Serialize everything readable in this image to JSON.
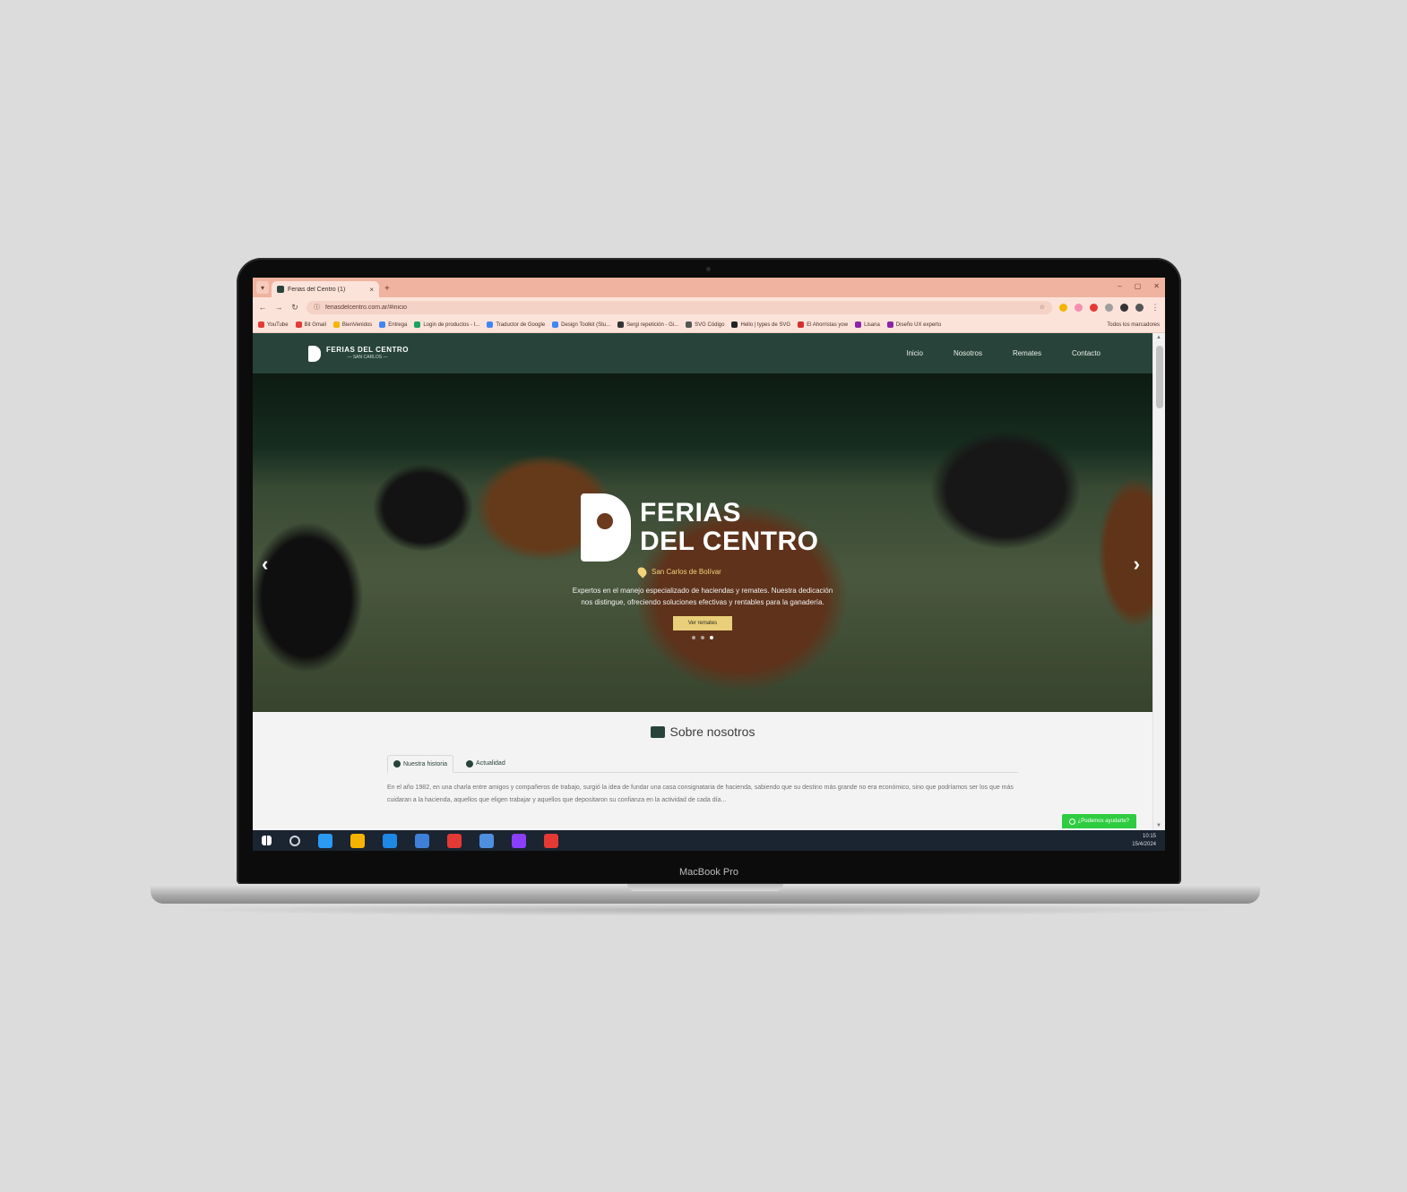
{
  "device": {
    "label": "MacBook Pro"
  },
  "browser": {
    "tab_title": "Ferias del Centro (1)",
    "url": "feriasdelcentro.com.ar/#inicio",
    "bookmarks": [
      {
        "label": "YouTube",
        "color": "#e53935"
      },
      {
        "label": "Bit Gmail",
        "color": "#e53935"
      },
      {
        "label": "BienVenidos",
        "color": "#f4b400"
      },
      {
        "label": "Entrega",
        "color": "#4285f4"
      },
      {
        "label": "Login de productos - I...",
        "color": "#1aa260"
      },
      {
        "label": "Traductor de Google",
        "color": "#4285f4"
      },
      {
        "label": "Design Toolkit (Stu...",
        "color": "#4285f4"
      },
      {
        "label": "Sergi repetición - Gi...",
        "color": "#333333"
      },
      {
        "label": "SVG Código",
        "color": "#555555"
      },
      {
        "label": "Hello | types de SVG",
        "color": "#222222"
      },
      {
        "label": "El Ahorristas yow",
        "color": "#d32f2f"
      },
      {
        "label": "Lisana",
        "color": "#8e24aa"
      },
      {
        "label": "Diseño UX experto",
        "color": "#8e24aa"
      }
    ],
    "bookmarks_right": "Todos los marcadores"
  },
  "site": {
    "logo_line1": "FERIAS DEL CENTRO",
    "logo_line2": "— SAN CARLOS —",
    "menu": [
      "Inicio",
      "Nosotros",
      "Remates",
      "Contacto"
    ],
    "hero": {
      "title_line1": "FERIAS",
      "title_line2": "DEL CENTRO",
      "location": "San Carlos de Bolívar",
      "description": "Expertos en el manejo especializado de haciendas y remates. Nuestra dedicación nos distingue, ofreciendo soluciones efectivas y rentables para la ganadería.",
      "button": "Ver remates",
      "slides": 3,
      "active_slide": 2
    },
    "about": {
      "title": "Sobre nosotros",
      "tabs": [
        "Nuestra historia",
        "Actualidad"
      ],
      "text": "En el año 1982, en una charla entre amigos y compañeros de trabajo, surgió la idea de fundar una casa consignataria de hacienda, sabiendo que su destino más grande no era económico, sino que podríamos ser los que más cuidaran a la hacienda, aquellos que eligen trabajar y aquellos que depositaron su confianza en la actividad de cada día...",
      "whatsapp": "¿Podemos ayudarte?"
    }
  },
  "taskbar": {
    "time": "10:15",
    "date": "15/4/2024",
    "icon_colors": [
      "#2b9af3",
      "#f4b400",
      "#1e88e5",
      "#3f7fd8",
      "#e53935",
      "#4f8fe0",
      "#8a3ffc",
      "#e53935"
    ]
  }
}
